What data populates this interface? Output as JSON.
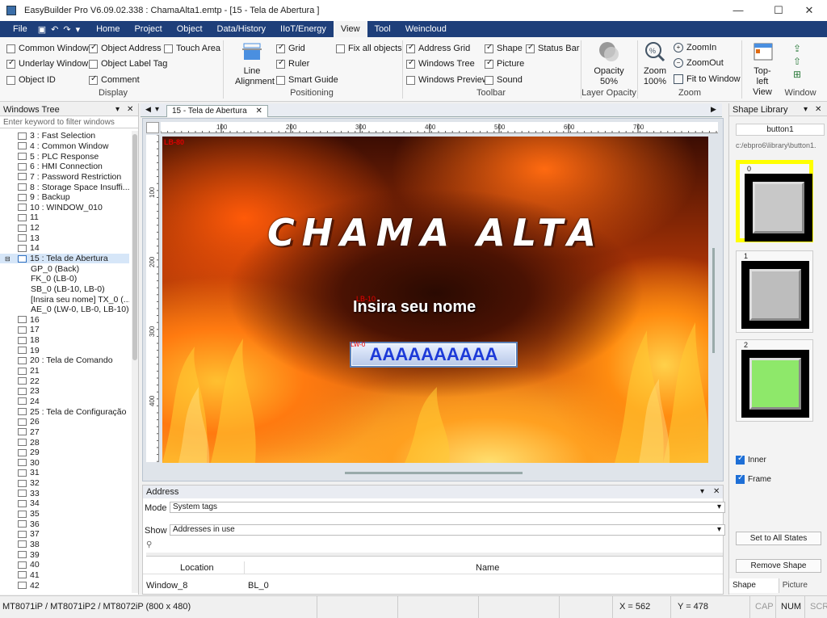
{
  "titlebar": {
    "title": "EasyBuilder Pro V6.09.02.338 : ChamaAlta1.emtp - [15 - Tela de Abertura ]",
    "minimize": "—",
    "maximize": "☐",
    "close": "✕"
  },
  "menu": {
    "file": "File",
    "items": [
      "Home",
      "Project",
      "Object",
      "Data/History",
      "IIoT/Energy",
      "View",
      "Tool",
      "Weincloud"
    ],
    "active": "View"
  },
  "ribbon": {
    "display": {
      "label": "Display",
      "options": [
        {
          "label": "Common Window",
          "checked": false
        },
        {
          "label": "Object Address",
          "checked": true
        },
        {
          "label": "Touch Area",
          "checked": false
        },
        {
          "label": "Underlay Window",
          "checked": true
        },
        {
          "label": "Object Label Tag",
          "checked": false
        },
        {
          "label": "Object ID",
          "checked": false
        },
        {
          "label": "Comment",
          "checked": true
        }
      ]
    },
    "positioning": {
      "label": "Positioning",
      "line_alignment": "Line Alignment",
      "options": [
        {
          "label": "Grid",
          "checked": true
        },
        {
          "label": "Fix all objects",
          "checked": false
        },
        {
          "label": "Ruler",
          "checked": true
        },
        {
          "label": "Smart Guide",
          "checked": false
        }
      ]
    },
    "toolbar": {
      "label": "Toolbar",
      "options": [
        {
          "label": "Address Grid",
          "checked": true
        },
        {
          "label": "Shape",
          "checked": true
        },
        {
          "label": "Status Bar",
          "checked": true
        },
        {
          "label": "Windows Tree",
          "checked": true
        },
        {
          "label": "Picture",
          "checked": true
        },
        {
          "label": "Windows Preview",
          "checked": false
        },
        {
          "label": "Sound",
          "checked": false
        }
      ]
    },
    "layer_opacity": {
      "label": "Layer Opacity",
      "title": "Opacity",
      "value": "50%"
    },
    "zoom": {
      "label": "Zoom",
      "title": "Zoom",
      "value": "100%",
      "zoom_in": "ZoomIn",
      "zoom_out": "ZoomOut",
      "fit": "Fit to Window"
    },
    "window": {
      "label": "Window",
      "top_left_view": "Top-left View"
    }
  },
  "windows_tree": {
    "title": "Windows Tree",
    "filter_placeholder": "Enter keyword to filter windows",
    "items": [
      {
        "label": "3 : Fast Selection",
        "level": 0
      },
      {
        "label": "4 : Common Window",
        "level": 0
      },
      {
        "label": "5 : PLC Response",
        "level": 0
      },
      {
        "label": "6 : HMI Connection",
        "level": 0
      },
      {
        "label": "7 : Password Restriction",
        "level": 0
      },
      {
        "label": "8 : Storage Space Insuffi...",
        "level": 0
      },
      {
        "label": "9 : Backup",
        "level": 0
      },
      {
        "label": "10 : WINDOW_010",
        "level": 0
      },
      {
        "label": "11",
        "level": 0
      },
      {
        "label": "12",
        "level": 0
      },
      {
        "label": "13",
        "level": 0
      },
      {
        "label": "14",
        "level": 0
      },
      {
        "label": "15 : Tela de Abertura",
        "level": 0,
        "selected": true,
        "expanded": true
      },
      {
        "label": "GP_0 (Back)",
        "level": 1
      },
      {
        "label": "FK_0 (LB-0)",
        "level": 1
      },
      {
        "label": "SB_0 (LB-10, LB-0)",
        "level": 1
      },
      {
        "label": "[Insira seu nome] TX_0 (...",
        "level": 1
      },
      {
        "label": "AE_0 (LW-0, LB-0, LB-10)",
        "level": 1
      },
      {
        "label": "16",
        "level": 0
      },
      {
        "label": "17",
        "level": 0
      },
      {
        "label": "18",
        "level": 0
      },
      {
        "label": "19",
        "level": 0
      },
      {
        "label": "20 : Tela de Comando",
        "level": 0
      },
      {
        "label": "21",
        "level": 0
      },
      {
        "label": "22",
        "level": 0
      },
      {
        "label": "23",
        "level": 0
      },
      {
        "label": "24",
        "level": 0
      },
      {
        "label": "25 : Tela de Configuração",
        "level": 0
      },
      {
        "label": "26",
        "level": 0
      },
      {
        "label": "27",
        "level": 0
      },
      {
        "label": "28",
        "level": 0
      },
      {
        "label": "29",
        "level": 0
      },
      {
        "label": "30",
        "level": 0
      },
      {
        "label": "31",
        "level": 0
      },
      {
        "label": "32",
        "level": 0
      },
      {
        "label": "33",
        "level": 0
      },
      {
        "label": "34",
        "level": 0
      },
      {
        "label": "35",
        "level": 0
      },
      {
        "label": "36",
        "level": 0
      },
      {
        "label": "37",
        "level": 0
      },
      {
        "label": "38",
        "level": 0
      },
      {
        "label": "39",
        "level": 0
      },
      {
        "label": "40",
        "level": 0
      },
      {
        "label": "41",
        "level": 0
      },
      {
        "label": "42",
        "level": 0
      }
    ]
  },
  "editor": {
    "tab": "15 - Tela de Abertura",
    "ruler_h": [
      "100",
      "200",
      "300",
      "400",
      "500",
      "600",
      "700"
    ],
    "ruler_v": [
      "100",
      "200",
      "300",
      "400"
    ],
    "canvas": {
      "lb80_tag": "LB-80",
      "title_art": "CHAMA ALTA",
      "prompt": "Insira seu nome",
      "prompt_tag": "LB-10",
      "name_value": "AAAAAAAAAA",
      "name_tag": "LW-0"
    }
  },
  "address": {
    "title": "Address",
    "mode_label": "Mode",
    "mode_value": "System tags",
    "show_label": "Show",
    "show_value": "Addresses in use",
    "columns": [
      "Location",
      "Name"
    ],
    "rows": [
      {
        "location": "Window_8",
        "name": "BL_0"
      }
    ]
  },
  "shape_library": {
    "title": "Shape Library",
    "name": "button1",
    "path": "c:/ebpro6\\library\\button1.",
    "states": [
      "0",
      "1",
      "2"
    ],
    "state_colors": [
      "#c8c8c8",
      "#bdbdbd",
      "#8ee86a"
    ],
    "inner": "Inner",
    "frame": "Frame",
    "set_all": "Set to All States",
    "remove": "Remove Shape",
    "tabs": [
      "Shape Libr...",
      "Picture Lib..."
    ]
  },
  "statusbar": {
    "model": "MT8071iP / MT8071iP2 / MT8072iP (800 x 480)",
    "x": "X = 562",
    "y": "Y = 478",
    "cap": "CAP",
    "num": "NUM",
    "scrl": "SCR"
  }
}
